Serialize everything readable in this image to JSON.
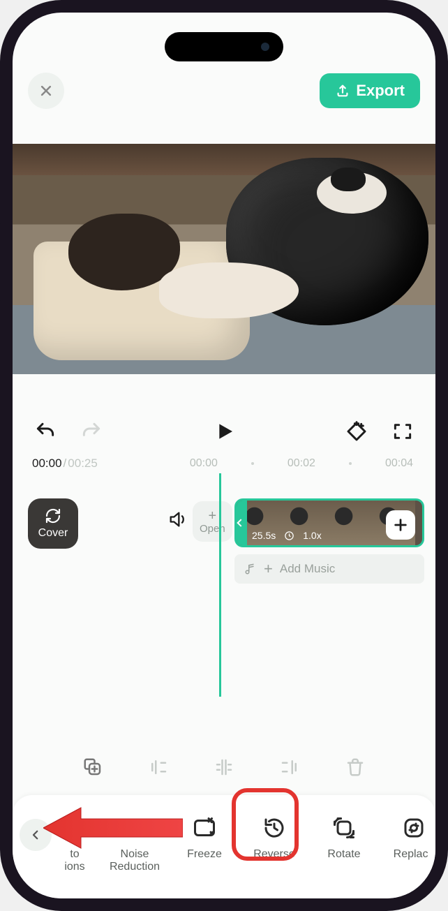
{
  "colors": {
    "accent": "#27c79a",
    "highlight": "#e3342f"
  },
  "header": {
    "export_label": "Export"
  },
  "playback": {
    "current": "00:00",
    "duration": "00:25",
    "ruler": [
      "00:00",
      "00:02",
      "00:04"
    ]
  },
  "timeline": {
    "cover_label": "Cover",
    "opening_label": "Open",
    "clip": {
      "duration": "25.5s",
      "speed": "1.0x"
    },
    "add_music_label": "Add Music"
  },
  "mid_tools": [
    "copy",
    "trim-left",
    "split",
    "trim-right",
    "delete"
  ],
  "bottom_tools": [
    {
      "id": "captions",
      "label": "to\nions",
      "icon": "captions-icon"
    },
    {
      "id": "noise",
      "label": "Noise\nReduction",
      "icon": "noise-icon"
    },
    {
      "id": "freeze",
      "label": "Freeze",
      "icon": "freeze-icon"
    },
    {
      "id": "reverse",
      "label": "Reverse",
      "icon": "reverse-icon"
    },
    {
      "id": "rotate",
      "label": "Rotate",
      "icon": "rotate-icon"
    },
    {
      "id": "replace",
      "label": "Replace",
      "icon": "replace-icon"
    }
  ],
  "annotation": {
    "highlighted_tool": "reverse",
    "arrow_target": "back-button"
  }
}
